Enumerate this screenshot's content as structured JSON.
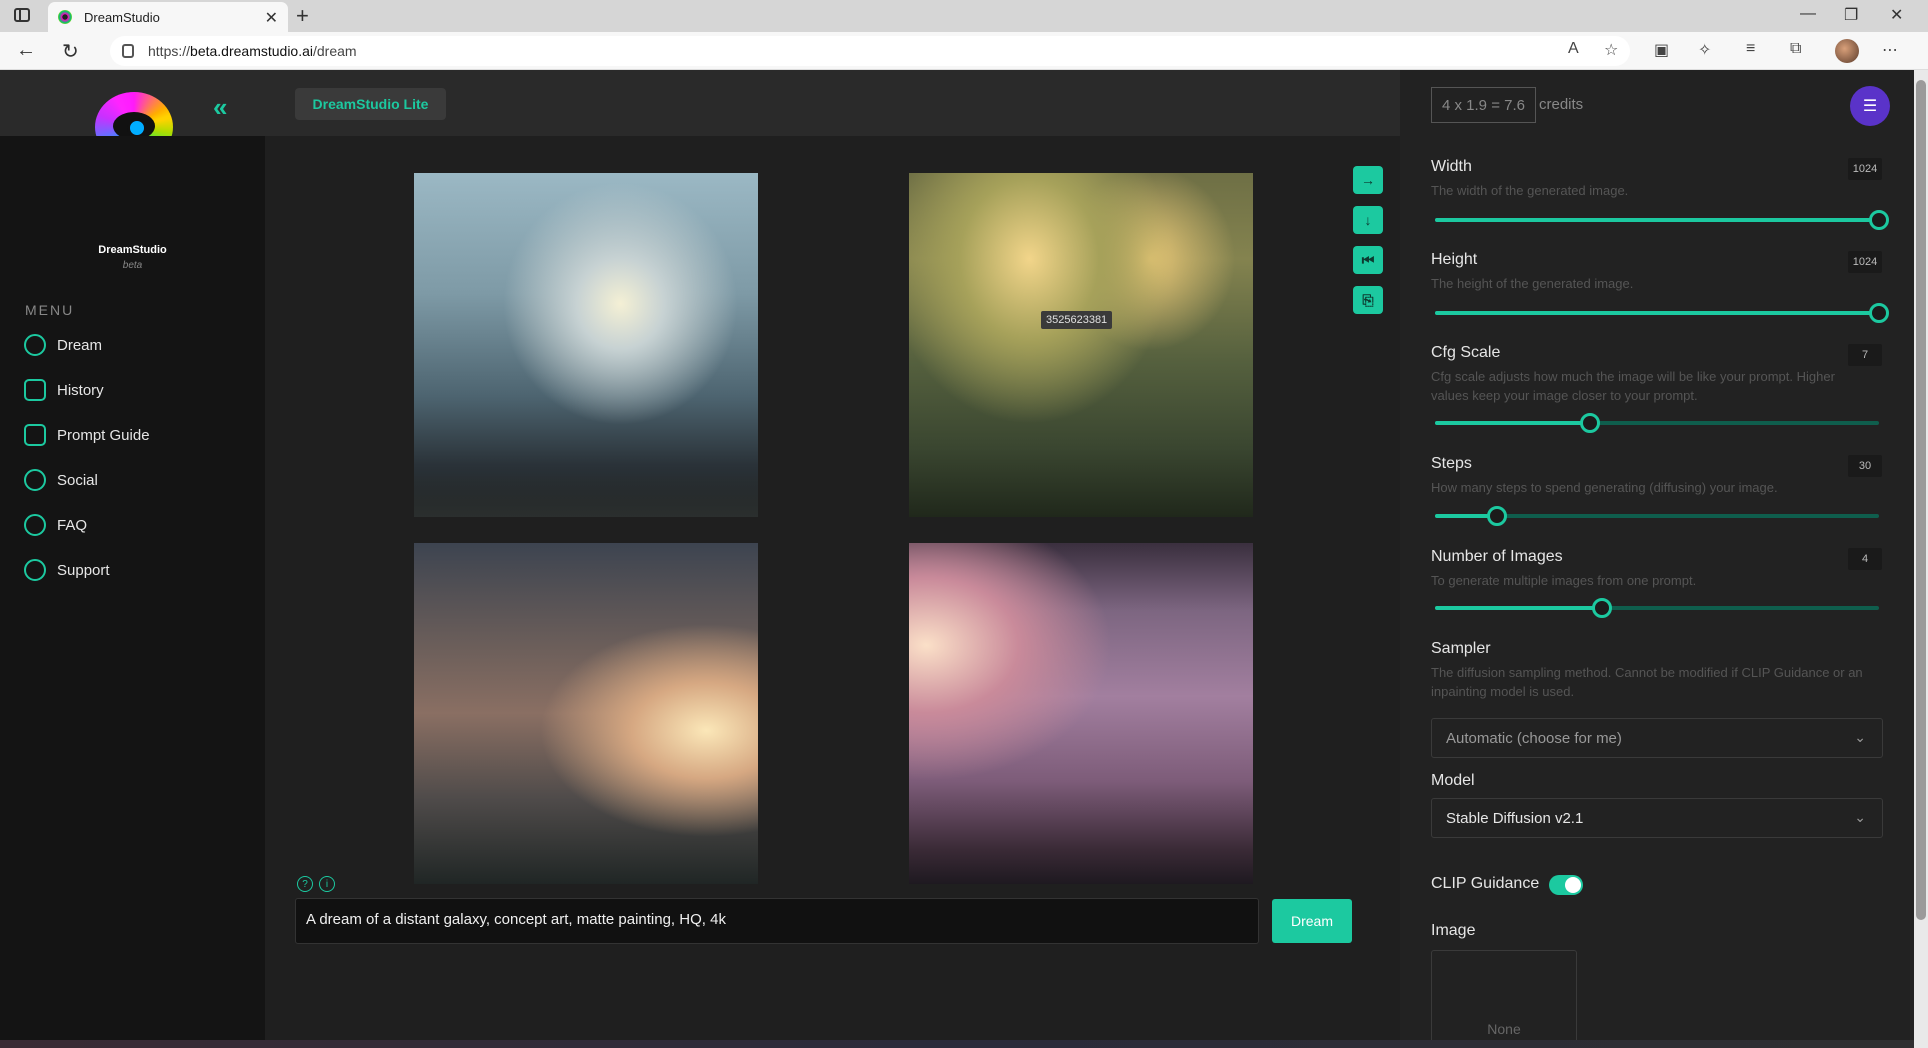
{
  "browser": {
    "tab_title": "DreamStudio",
    "tab_close": "✕",
    "new_tab": "+",
    "url_scheme": "https://",
    "url_host": "beta.dreamstudio.ai",
    "url_path": "/dream",
    "window_controls": [
      "—",
      "❐",
      "✕"
    ],
    "toolbar_icons": [
      "read-aloud-icon",
      "favorites-add-icon",
      "wallet-icon",
      "extensions-icon",
      "favorites-icon",
      "collections-icon",
      "profile-icon",
      "more-icon"
    ]
  },
  "app": {
    "brand": "DreamStudio",
    "brand_sub": "beta",
    "lite_button": "DreamStudio Lite",
    "collapse_icon": "«",
    "menu_label": "MENU",
    "menu": [
      {
        "label": "Dream",
        "icon": "dream-icon"
      },
      {
        "label": "History",
        "icon": "history-icon"
      },
      {
        "label": "Prompt Guide",
        "icon": "prompt-guide-icon"
      },
      {
        "label": "Social",
        "icon": "social-icon"
      },
      {
        "label": "FAQ",
        "icon": "faq-icon"
      },
      {
        "label": "Support",
        "icon": "support-icon"
      }
    ],
    "accent": "#1cc9a0"
  },
  "gallery": {
    "seed_tooltip": "3525623381",
    "actions": [
      "→",
      "↓",
      "⏮",
      "⎘"
    ],
    "help_icons": [
      "?",
      "i"
    ],
    "prompt_value": "A dream of a distant galaxy, concept art, matte painting, HQ, 4k",
    "dream_button": "Dream"
  },
  "panel": {
    "credits_formula": "4 x 1.9 = 7.6",
    "credits_label": "credits",
    "avatar_icon": "☰",
    "width": {
      "title": "Width",
      "desc": "The width of the generated image.",
      "value": "1024"
    },
    "height": {
      "title": "Height",
      "desc": "The height of the generated image.",
      "value": "1024"
    },
    "cfg": {
      "title": "Cfg Scale",
      "desc": "Cfg scale adjusts how much the image will be like your prompt. Higher values keep your image closer to your prompt.",
      "value": "7"
    },
    "steps": {
      "title": "Steps",
      "desc": "How many steps to spend generating (diffusing) your image.",
      "value": "30"
    },
    "num_images": {
      "title": "Number of Images",
      "desc": "To generate multiple images from one prompt.",
      "value": "4"
    },
    "sampler": {
      "title": "Sampler",
      "desc": "The diffusion sampling method. Cannot be modified if CLIP Guidance or an inpainting model is used.",
      "value": "Automatic (choose for me)"
    },
    "model": {
      "title": "Model",
      "value": "Stable Diffusion v2.1"
    },
    "clip": {
      "title": "CLIP Guidance",
      "enabled": true
    },
    "image": {
      "title": "Image",
      "value": "None"
    }
  }
}
